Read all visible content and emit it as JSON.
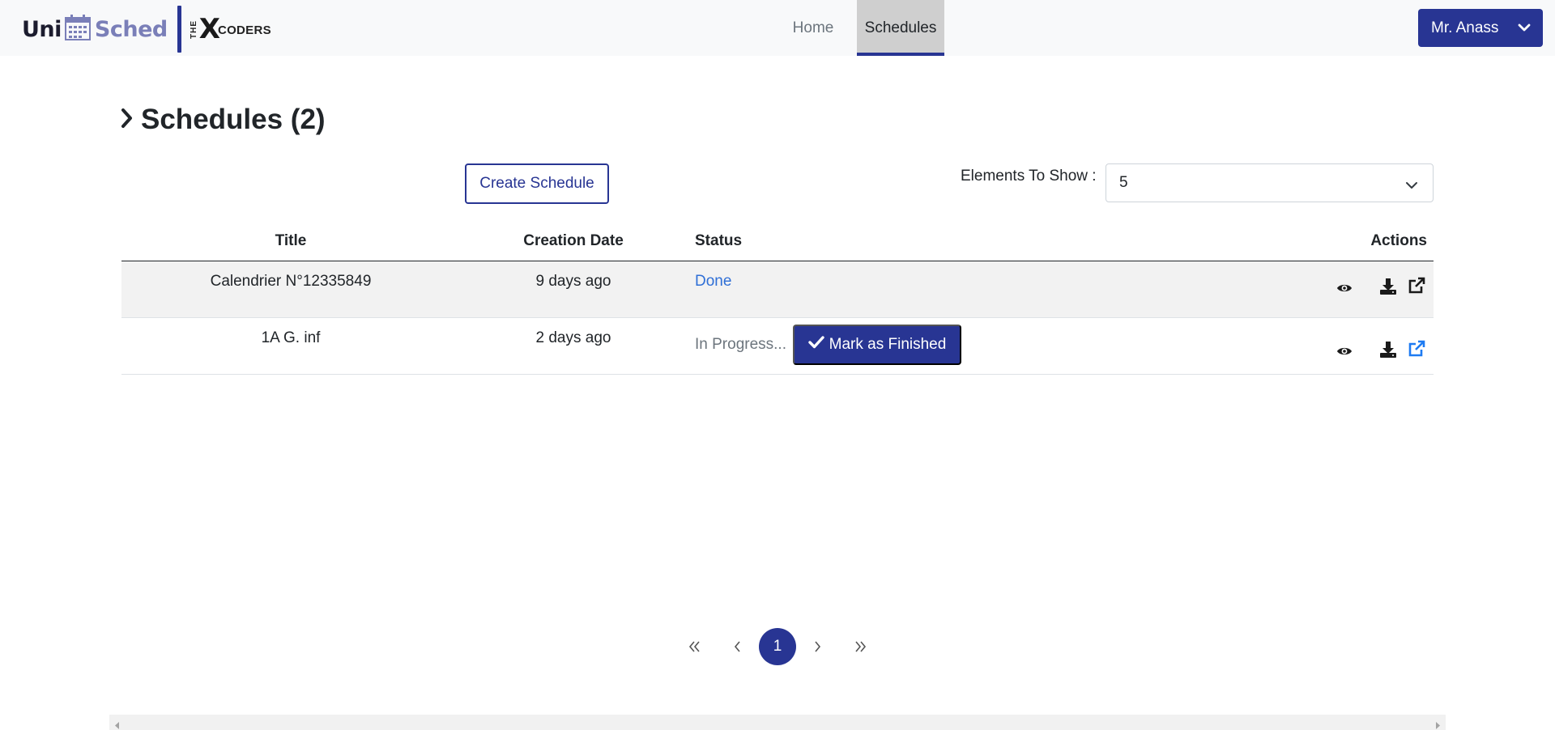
{
  "brand": {
    "uni": "Uni",
    "sched": "Sched",
    "the": "THE",
    "x": "X",
    "coders": "CODERS"
  },
  "nav": {
    "home": "Home",
    "schedules": "Schedules",
    "active": "Schedules"
  },
  "user": {
    "name": "Mr. Anass"
  },
  "page": {
    "title": "Schedules (2)"
  },
  "controls": {
    "create_label": "Create Schedule",
    "elements_label": "Elements To Show :",
    "elements_value": "5"
  },
  "table": {
    "headers": {
      "title": "Title",
      "creation_date": "Creation Date",
      "status": "Status",
      "actions": "Actions"
    },
    "rows": [
      {
        "title": "Calendrier N°12335849",
        "creation_date": "9 days ago",
        "status": "Done"
      },
      {
        "title": "1A G. inf",
        "creation_date": "2 days ago",
        "status": "In Progress...",
        "action_label": "Mark as Finished"
      }
    ]
  },
  "pagination": {
    "current": "1"
  },
  "icons": {
    "view": "eye-icon",
    "download": "download-icon",
    "open": "external-link-icon",
    "first": "double-chevron-left-icon",
    "prev": "chevron-left-icon",
    "next": "chevron-right-icon",
    "last": "double-chevron-right-icon"
  },
  "colors": {
    "primary": "#283593",
    "link": "#2f6fd6",
    "navbar": "#f8f9fa",
    "row_stripe": "#f2f2f2"
  }
}
